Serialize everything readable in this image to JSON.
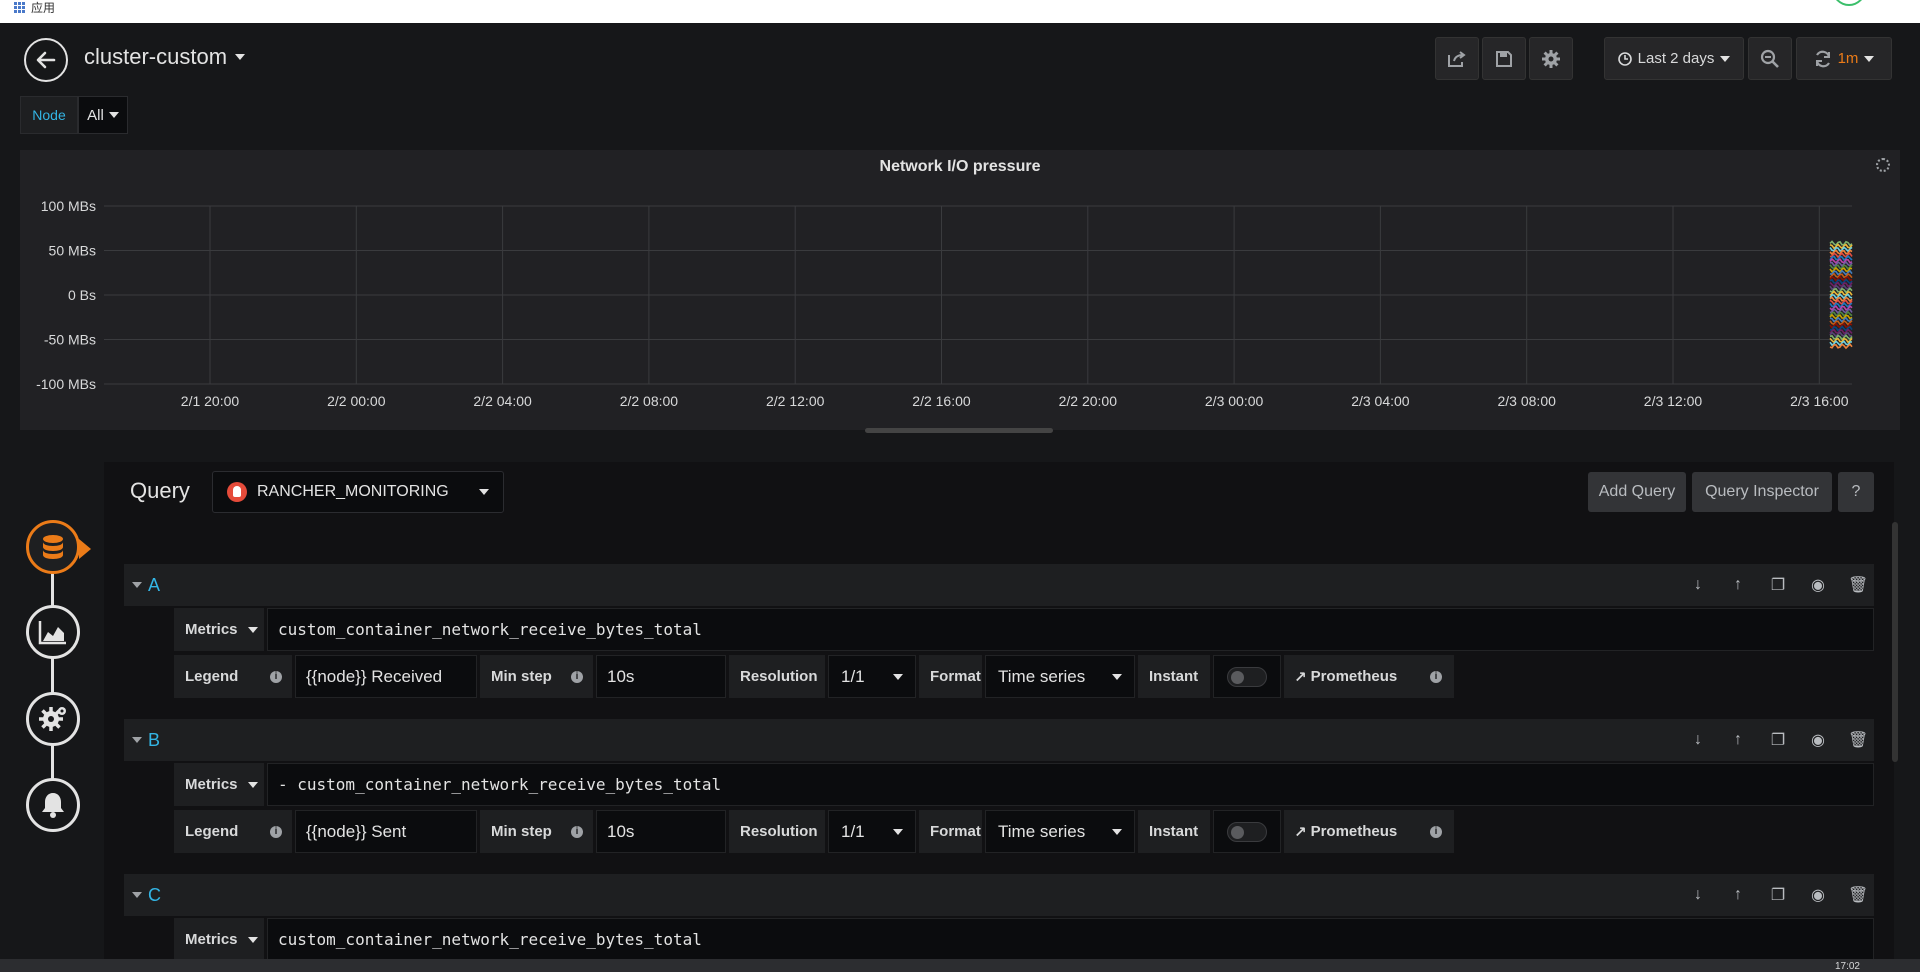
{
  "browser": {
    "apps_label": "应用"
  },
  "navbar": {
    "title": "cluster-custom",
    "share_icon": "share-icon",
    "save_icon": "save-icon",
    "settings_icon": "gear-icon",
    "time_range": "Last 2 days",
    "refresh_interval": "1m"
  },
  "variables": {
    "node_label": "Node",
    "node_value": "All"
  },
  "panel": {
    "title": "Network I/O pressure"
  },
  "chart_data": {
    "type": "line",
    "title": "Network I/O pressure",
    "y_ticks": [
      "100 MBs",
      "50 MBs",
      "0 Bs",
      "-50 MBs",
      "-100 MBs"
    ],
    "x_ticks": [
      "2/1 20:00",
      "2/2 00:00",
      "2/2 04:00",
      "2/2 08:00",
      "2/2 12:00",
      "2/2 16:00",
      "2/2 20:00",
      "2/3 00:00",
      "2/3 04:00",
      "2/3 08:00",
      "2/3 12:00",
      "2/3 16:00"
    ],
    "ylim": [
      -100,
      100
    ],
    "grid": true,
    "series_colors": [
      "#7eb26d",
      "#eab839",
      "#6ed0e0",
      "#ef843c",
      "#e24d42",
      "#1f78c1",
      "#ba43a9",
      "#705da0",
      "#508642",
      "#cca300",
      "#447ebc",
      "#c15c17",
      "#890f02",
      "#0a437c",
      "#6d1f62",
      "#584477"
    ],
    "series_note": "many node series, visible only at the far right (≈2/3 16:00 onward)"
  },
  "editor": {
    "title": "Query",
    "datasource": "RANCHER_MONITORING",
    "add_query": "Add Query",
    "query_inspector": "Query Inspector",
    "help": "?",
    "queries": [
      {
        "letter": "A",
        "metrics_label": "Metrics",
        "expr": "custom_container_network_receive_bytes_total",
        "legend_label": "Legend",
        "legend": "{{node}} Received",
        "min_step_label": "Min step",
        "min_step": "10s",
        "resolution_label": "Resolution",
        "resolution": "1/1",
        "format_label": "Format",
        "format": "Time series",
        "instant_label": "Instant",
        "prometheus_label": "Prometheus"
      },
      {
        "letter": "B",
        "metrics_label": "Metrics",
        "expr": "- custom_container_network_receive_bytes_total",
        "legend_label": "Legend",
        "legend": "{{node}} Sent",
        "min_step_label": "Min step",
        "min_step": "10s",
        "resolution_label": "Resolution",
        "resolution": "1/1",
        "format_label": "Format",
        "format": "Time series",
        "instant_label": "Instant",
        "prometheus_label": "Prometheus"
      },
      {
        "letter": "C",
        "metrics_label": "Metrics",
        "expr": "custom_container_network_receive_bytes_total"
      }
    ]
  },
  "taskbar": {
    "clock": "17:02"
  }
}
